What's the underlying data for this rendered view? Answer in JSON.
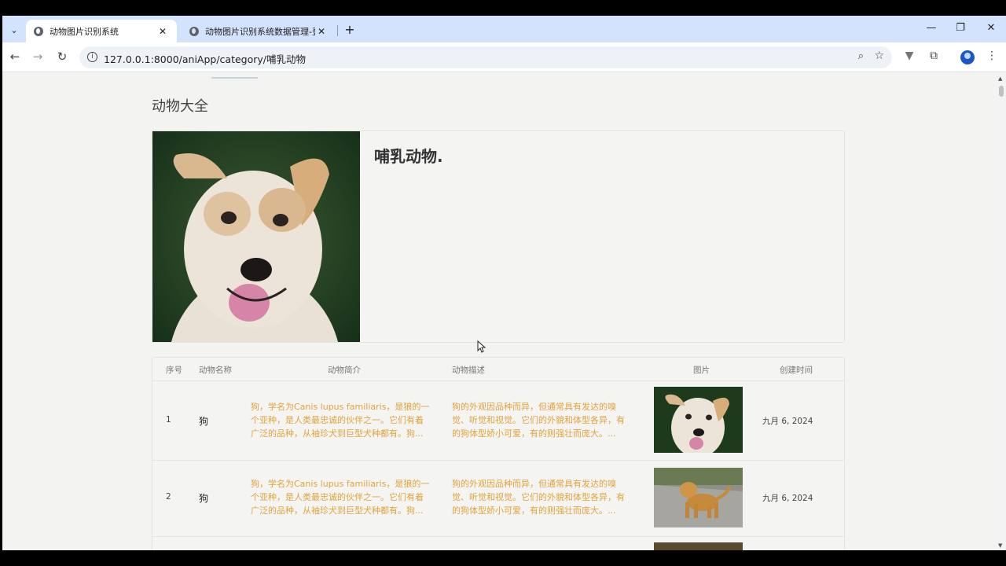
{
  "browser": {
    "tabs": [
      {
        "title": "动物图片识别系统",
        "active": true
      },
      {
        "title": "动物图片识别系统数据管理-登录",
        "active": false
      }
    ],
    "url": "127.0.0.1:8000/aniApp/category/哺乳动物"
  },
  "page": {
    "title": "动物大全",
    "category_title": "哺乳动物."
  },
  "table": {
    "headers": [
      "序号",
      "动物名称",
      "动物简介",
      "动物描述",
      "图片",
      "创建时间"
    ],
    "rows": [
      {
        "index": "1",
        "name": "狗",
        "intro": "狗，学名为Canis lupus familiaris，是狼的一个亚种，是人类最忠诚的伙伴之一。它们有着广泛的品种，从袖珍犬到巨型犬种都有。狗...",
        "description": "狗的外观因品种而异，但通常具有发达的嗅觉、听觉和视觉。它们的外貌和体型各异，有的狗体型娇小可爱，有的则强壮而庞大。...",
        "date": "九月 6, 2024"
      },
      {
        "index": "2",
        "name": "狗",
        "intro": "狗，学名为Canis lupus familiaris，是狼的一个亚种，是人类最忠诚的伙伴之一。它们有着广泛的品种，从袖珍犬到巨型犬种都有。狗...",
        "description": "狗的外观因品种而异，但通常具有发达的嗅觉、听觉和视觉。它们的外貌和体型各异，有的狗体型娇小可爱，有的则强壮而庞大。...",
        "date": "九月 6, 2024"
      }
    ]
  },
  "colors": {
    "accent_text": "#e3a23a",
    "tabstrip": "#d3e3fd"
  }
}
